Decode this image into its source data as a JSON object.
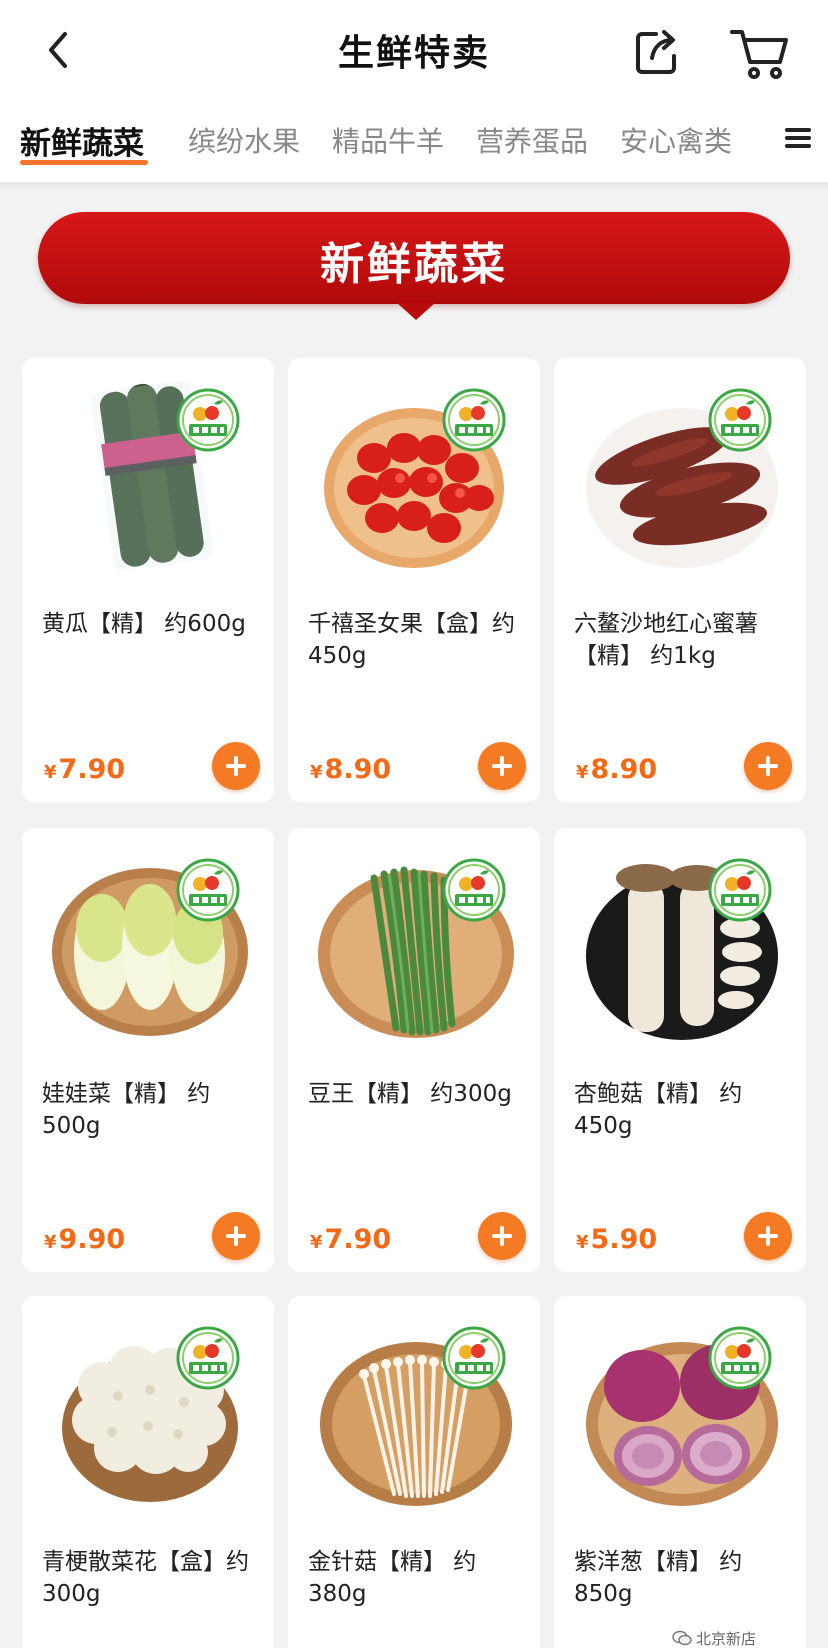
{
  "header": {
    "title": "生鲜特卖"
  },
  "tabs": [
    {
      "label": "新鲜蔬菜",
      "active": true
    },
    {
      "label": "缤纷水果",
      "active": false
    },
    {
      "label": "精品牛羊",
      "active": false
    },
    {
      "label": "营养蛋品",
      "active": false
    },
    {
      "label": "安心禽类",
      "active": false
    }
  ],
  "banner": {
    "text": "新鲜蔬菜"
  },
  "currency_symbol": "¥",
  "accent_color": "#f47a24",
  "products": [
    {
      "name": "黄瓜【精】 约600g",
      "price": "7.90",
      "image": "cucumber"
    },
    {
      "name": "千禧圣女果【盒】约450g",
      "price": "8.90",
      "image": "cherry-tomato"
    },
    {
      "name": "六鳌沙地红心蜜薯【精】 约1kg",
      "price": "8.90",
      "image": "sweet-potato"
    },
    {
      "name": "娃娃菜【精】 约500g",
      "price": "9.90",
      "image": "baby-cabbage"
    },
    {
      "name": "豆王【精】 约300g",
      "price": "7.90",
      "image": "green-bean"
    },
    {
      "name": "杏鲍菇【精】 约450g",
      "price": "5.90",
      "image": "king-oyster-mushroom"
    },
    {
      "name": "青梗散菜花【盒】约300g",
      "price": "",
      "image": "cauliflower"
    },
    {
      "name": "金针菇【精】 约380g",
      "price": "",
      "image": "enoki-mushroom"
    },
    {
      "name": "紫洋葱【精】 约850g",
      "price": "",
      "image": "red-onion"
    }
  ],
  "watermark": {
    "text": "北京新店"
  }
}
